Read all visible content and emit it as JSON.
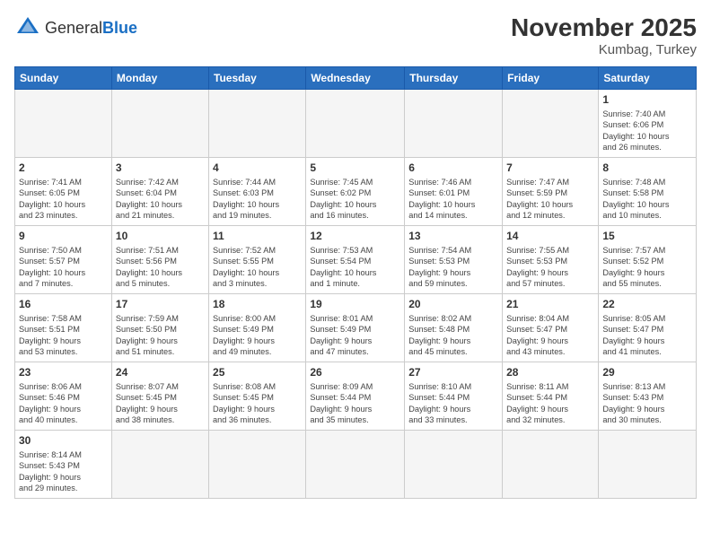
{
  "header": {
    "logo_general": "General",
    "logo_blue": "Blue",
    "month_year": "November 2025",
    "location": "Kumbag, Turkey"
  },
  "weekdays": [
    "Sunday",
    "Monday",
    "Tuesday",
    "Wednesday",
    "Thursday",
    "Friday",
    "Saturday"
  ],
  "weeks": [
    [
      {
        "day": "",
        "info": ""
      },
      {
        "day": "",
        "info": ""
      },
      {
        "day": "",
        "info": ""
      },
      {
        "day": "",
        "info": ""
      },
      {
        "day": "",
        "info": ""
      },
      {
        "day": "",
        "info": ""
      },
      {
        "day": "1",
        "info": "Sunrise: 7:40 AM\nSunset: 6:06 PM\nDaylight: 10 hours\nand 26 minutes."
      }
    ],
    [
      {
        "day": "2",
        "info": "Sunrise: 7:41 AM\nSunset: 6:05 PM\nDaylight: 10 hours\nand 23 minutes."
      },
      {
        "day": "3",
        "info": "Sunrise: 7:42 AM\nSunset: 6:04 PM\nDaylight: 10 hours\nand 21 minutes."
      },
      {
        "day": "4",
        "info": "Sunrise: 7:44 AM\nSunset: 6:03 PM\nDaylight: 10 hours\nand 19 minutes."
      },
      {
        "day": "5",
        "info": "Sunrise: 7:45 AM\nSunset: 6:02 PM\nDaylight: 10 hours\nand 16 minutes."
      },
      {
        "day": "6",
        "info": "Sunrise: 7:46 AM\nSunset: 6:01 PM\nDaylight: 10 hours\nand 14 minutes."
      },
      {
        "day": "7",
        "info": "Sunrise: 7:47 AM\nSunset: 5:59 PM\nDaylight: 10 hours\nand 12 minutes."
      },
      {
        "day": "8",
        "info": "Sunrise: 7:48 AM\nSunset: 5:58 PM\nDaylight: 10 hours\nand 10 minutes."
      }
    ],
    [
      {
        "day": "9",
        "info": "Sunrise: 7:50 AM\nSunset: 5:57 PM\nDaylight: 10 hours\nand 7 minutes."
      },
      {
        "day": "10",
        "info": "Sunrise: 7:51 AM\nSunset: 5:56 PM\nDaylight: 10 hours\nand 5 minutes."
      },
      {
        "day": "11",
        "info": "Sunrise: 7:52 AM\nSunset: 5:55 PM\nDaylight: 10 hours\nand 3 minutes."
      },
      {
        "day": "12",
        "info": "Sunrise: 7:53 AM\nSunset: 5:54 PM\nDaylight: 10 hours\nand 1 minute."
      },
      {
        "day": "13",
        "info": "Sunrise: 7:54 AM\nSunset: 5:53 PM\nDaylight: 9 hours\nand 59 minutes."
      },
      {
        "day": "14",
        "info": "Sunrise: 7:55 AM\nSunset: 5:53 PM\nDaylight: 9 hours\nand 57 minutes."
      },
      {
        "day": "15",
        "info": "Sunrise: 7:57 AM\nSunset: 5:52 PM\nDaylight: 9 hours\nand 55 minutes."
      }
    ],
    [
      {
        "day": "16",
        "info": "Sunrise: 7:58 AM\nSunset: 5:51 PM\nDaylight: 9 hours\nand 53 minutes."
      },
      {
        "day": "17",
        "info": "Sunrise: 7:59 AM\nSunset: 5:50 PM\nDaylight: 9 hours\nand 51 minutes."
      },
      {
        "day": "18",
        "info": "Sunrise: 8:00 AM\nSunset: 5:49 PM\nDaylight: 9 hours\nand 49 minutes."
      },
      {
        "day": "19",
        "info": "Sunrise: 8:01 AM\nSunset: 5:49 PM\nDaylight: 9 hours\nand 47 minutes."
      },
      {
        "day": "20",
        "info": "Sunrise: 8:02 AM\nSunset: 5:48 PM\nDaylight: 9 hours\nand 45 minutes."
      },
      {
        "day": "21",
        "info": "Sunrise: 8:04 AM\nSunset: 5:47 PM\nDaylight: 9 hours\nand 43 minutes."
      },
      {
        "day": "22",
        "info": "Sunrise: 8:05 AM\nSunset: 5:47 PM\nDaylight: 9 hours\nand 41 minutes."
      }
    ],
    [
      {
        "day": "23",
        "info": "Sunrise: 8:06 AM\nSunset: 5:46 PM\nDaylight: 9 hours\nand 40 minutes."
      },
      {
        "day": "24",
        "info": "Sunrise: 8:07 AM\nSunset: 5:45 PM\nDaylight: 9 hours\nand 38 minutes."
      },
      {
        "day": "25",
        "info": "Sunrise: 8:08 AM\nSunset: 5:45 PM\nDaylight: 9 hours\nand 36 minutes."
      },
      {
        "day": "26",
        "info": "Sunrise: 8:09 AM\nSunset: 5:44 PM\nDaylight: 9 hours\nand 35 minutes."
      },
      {
        "day": "27",
        "info": "Sunrise: 8:10 AM\nSunset: 5:44 PM\nDaylight: 9 hours\nand 33 minutes."
      },
      {
        "day": "28",
        "info": "Sunrise: 8:11 AM\nSunset: 5:44 PM\nDaylight: 9 hours\nand 32 minutes."
      },
      {
        "day": "29",
        "info": "Sunrise: 8:13 AM\nSunset: 5:43 PM\nDaylight: 9 hours\nand 30 minutes."
      }
    ],
    [
      {
        "day": "30",
        "info": "Sunrise: 8:14 AM\nSunset: 5:43 PM\nDaylight: 9 hours\nand 29 minutes."
      },
      {
        "day": "",
        "info": ""
      },
      {
        "day": "",
        "info": ""
      },
      {
        "day": "",
        "info": ""
      },
      {
        "day": "",
        "info": ""
      },
      {
        "day": "",
        "info": ""
      },
      {
        "day": "",
        "info": ""
      }
    ]
  ]
}
